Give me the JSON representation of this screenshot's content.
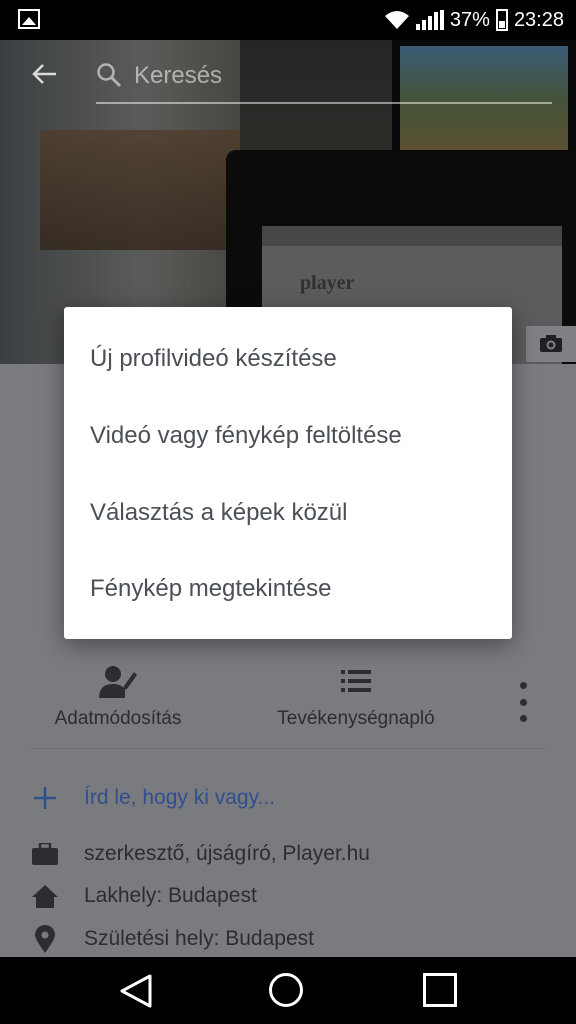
{
  "status_bar": {
    "battery_percent": "37%",
    "time": "23:28"
  },
  "search": {
    "placeholder": "Keresés"
  },
  "dialog": {
    "items": [
      "Új profilvideó készítése",
      "Videó vagy fénykép feltöltése",
      "Választás a képek közül",
      "Fénykép megtekintése"
    ]
  },
  "actions": {
    "edit_label": "Adatmódosítás",
    "activity_label": "Tevékenységnapló"
  },
  "about": {
    "intro": "Írd le, hogy ki vagy...",
    "work": "szerkesztő, újságíró, Player.hu",
    "residence": "Lakhely: Budapest",
    "birthplace": "Születési hely: Budapest"
  },
  "cover_photo": {
    "browser_logo_text": "player"
  },
  "icons": [
    "image-icon",
    "wifi-icon",
    "signal-icon",
    "battery-icon",
    "back-arrow-icon",
    "search-icon",
    "camera-icon",
    "edit-profile-icon",
    "activity-log-icon",
    "more-icon",
    "plus-icon",
    "briefcase-icon",
    "home-icon",
    "location-pin-icon",
    "nav-back-icon",
    "nav-home-icon",
    "nav-recent-icon"
  ]
}
